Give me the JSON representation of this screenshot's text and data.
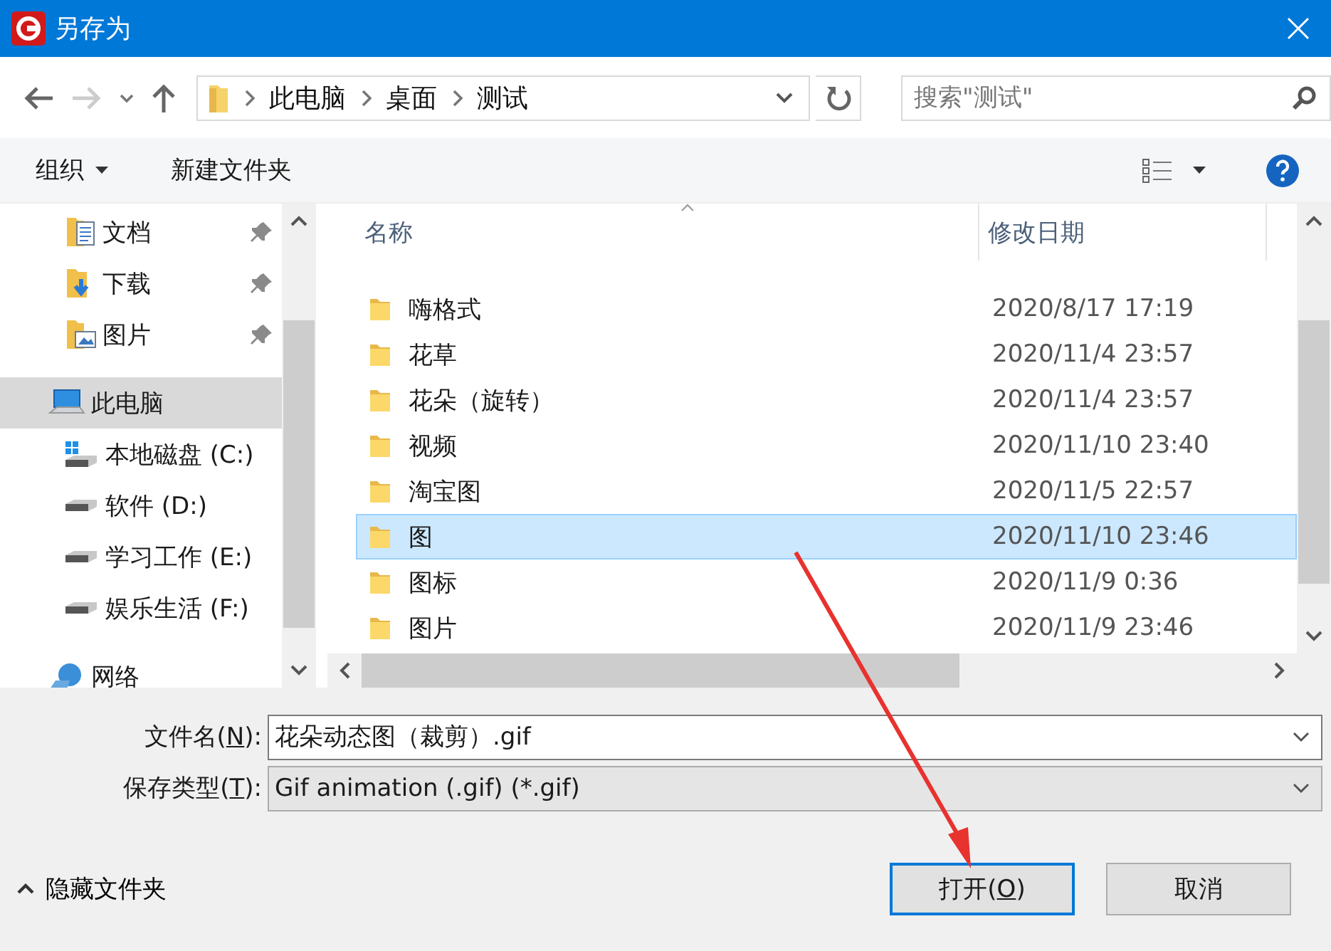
{
  "window": {
    "title": "另存为"
  },
  "breadcrumb": [
    "此电脑",
    "桌面",
    "测试"
  ],
  "search": {
    "placeholder": "搜索\"测试\""
  },
  "toolbar": {
    "organize": "组织",
    "new_folder": "新建文件夹"
  },
  "sidebar": {
    "items": [
      {
        "label": "文档",
        "kind": "documents",
        "pinned": true,
        "selected": false
      },
      {
        "label": "下载",
        "kind": "downloads",
        "pinned": true,
        "selected": false
      },
      {
        "label": "图片",
        "kind": "pictures",
        "pinned": true,
        "selected": false
      },
      {
        "label": "此电脑",
        "kind": "computer",
        "pinned": false,
        "selected": true,
        "children": [
          {
            "label": "本地磁盘 (C:)",
            "kind": "system-drive",
            "pinned": false,
            "selected": false
          },
          {
            "label": "软件 (D:)",
            "kind": "drive",
            "pinned": false,
            "selected": false
          },
          {
            "label": "学习工作 (E:)",
            "kind": "drive",
            "pinned": false,
            "selected": false
          },
          {
            "label": "娱乐生活 (F:)",
            "kind": "drive",
            "pinned": false,
            "selected": false
          }
        ]
      },
      {
        "label": "网络",
        "kind": "network",
        "pinned": false,
        "selected": false
      }
    ]
  },
  "table": {
    "columns": [
      "名称",
      "修改日期"
    ],
    "rows": [
      {
        "name": "嗨格式",
        "modified": "2020/8/17 17:19",
        "selected": false
      },
      {
        "name": "花草",
        "modified": "2020/11/4 23:57",
        "selected": false
      },
      {
        "name": "花朵（旋转）",
        "modified": "2020/11/4 23:57",
        "selected": false
      },
      {
        "name": "视频",
        "modified": "2020/11/10 23:40",
        "selected": false
      },
      {
        "name": "淘宝图",
        "modified": "2020/11/5 22:57",
        "selected": false
      },
      {
        "name": "图",
        "modified": "2020/11/10 23:46",
        "selected": true
      },
      {
        "name": "图标",
        "modified": "2020/11/9 0:36",
        "selected": false
      },
      {
        "name": "图片",
        "modified": "2020/11/9 23:46",
        "selected": false
      }
    ]
  },
  "form": [
    {
      "label_before": "文件名(",
      "access_key": "N",
      "label_after": "):",
      "value": "花朵动态图（裁剪）.gif",
      "kind": "editable"
    },
    {
      "label_before": "保存类型(",
      "access_key": "T",
      "label_after": "):",
      "value": "Gif animation (.gif) (*.gif)",
      "kind": "select"
    }
  ],
  "hide_folders": "隐藏文件夹",
  "buttons": [
    {
      "label_before": "打开(",
      "access_key": "O",
      "label_after": ")",
      "default": true
    },
    {
      "label_before": "取消",
      "default": false
    }
  ]
}
